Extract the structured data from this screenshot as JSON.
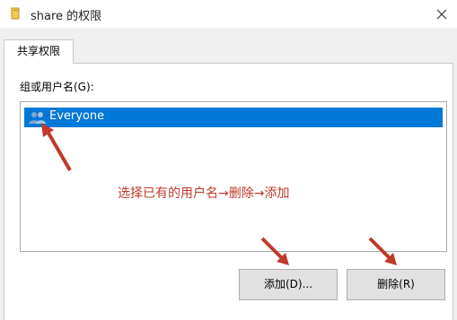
{
  "window": {
    "title": "share 的权限"
  },
  "tabs": [
    {
      "label": "共享权限"
    }
  ],
  "group": {
    "label": "组或用户名(G):",
    "items": [
      {
        "label": "Everyone",
        "selected": true
      }
    ]
  },
  "annotation": {
    "text": "选择已有的用户名→删除→添加",
    "color": "#c0392b"
  },
  "buttons": {
    "add_label": "添加(D)...",
    "remove_label": "删除(R)"
  },
  "colors": {
    "selection": "#0078d7",
    "dialog_bg": "#f0f0f0",
    "arrow": "#c0392b"
  },
  "icons": {
    "title": "folder-icon",
    "close": "close-icon",
    "user_group": "users-icon"
  }
}
